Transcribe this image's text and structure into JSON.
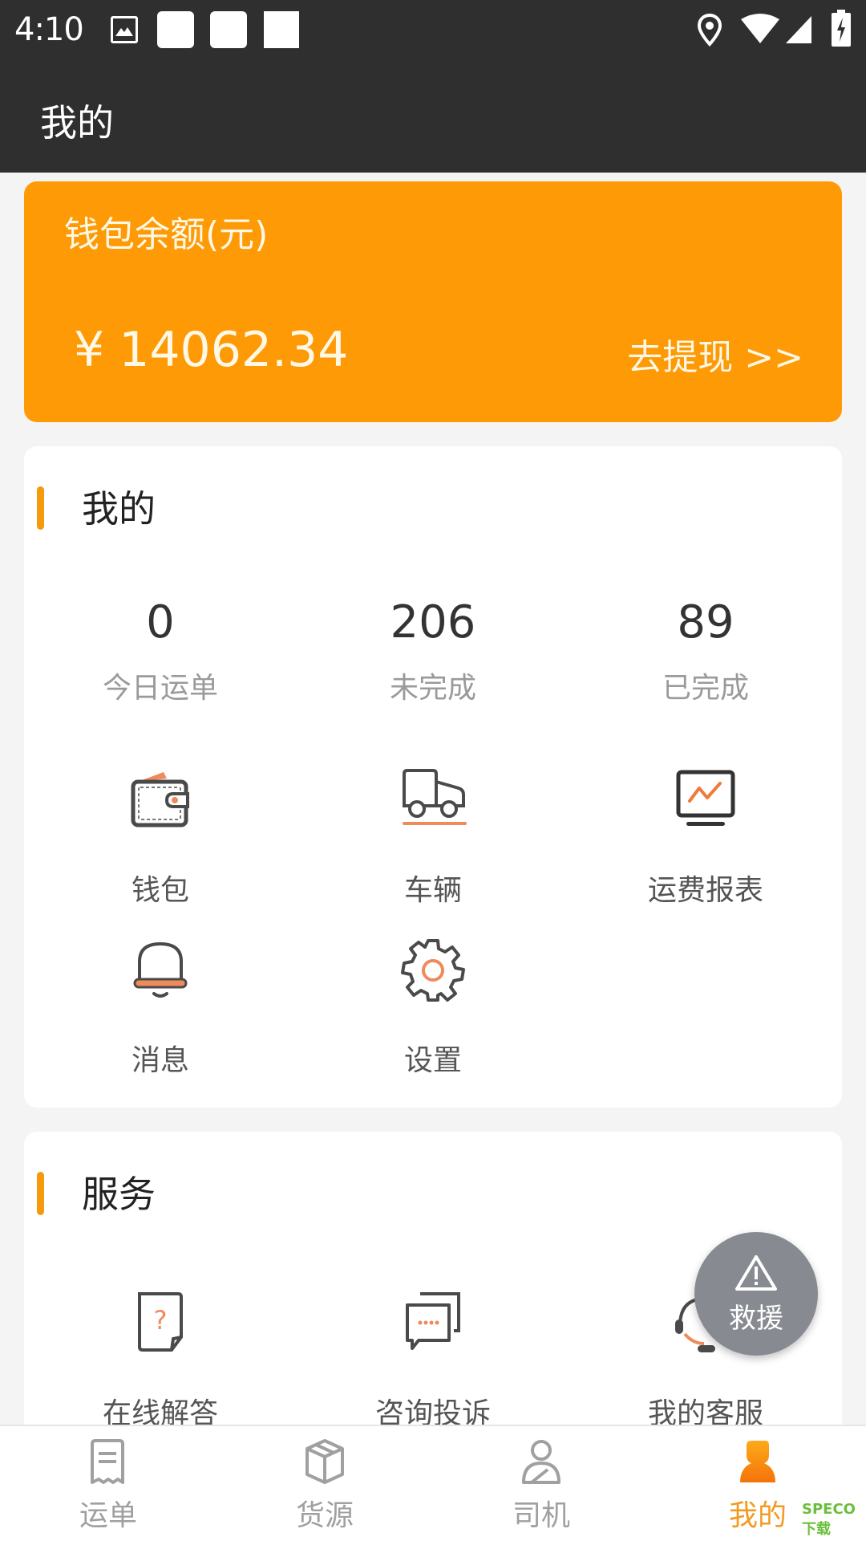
{
  "status_bar": {
    "time": "4:10",
    "left_icons": [
      "image-icon",
      "notification-placeholder",
      "notification-placeholder",
      "notification-placeholder"
    ],
    "right_icons": [
      "location-icon",
      "wifi-icon",
      "signal-icon",
      "battery-charging-icon"
    ]
  },
  "app_bar": {
    "title": "我的"
  },
  "wallet": {
    "label": "钱包余额(元)",
    "currency_symbol": "¥",
    "balance": "14062.34",
    "withdraw_label": "去提现 >>",
    "background_color": "#fd9a06"
  },
  "mine_section": {
    "title": "我的",
    "stats": [
      {
        "value": "0",
        "label": "今日运单"
      },
      {
        "value": "206",
        "label": "未完成"
      },
      {
        "value": "89",
        "label": "已完成"
      }
    ],
    "items": [
      {
        "label": "钱包",
        "icon": "wallet-icon"
      },
      {
        "label": "车辆",
        "icon": "truck-icon"
      },
      {
        "label": "运费报表",
        "icon": "report-chart-icon"
      },
      {
        "label": "消息",
        "icon": "bell-icon"
      },
      {
        "label": "设置",
        "icon": "gear-icon"
      }
    ]
  },
  "service_section": {
    "title": "服务",
    "items": [
      {
        "label": "在线解答",
        "icon": "question-doc-icon"
      },
      {
        "label": "咨询投诉",
        "icon": "chat-bubbles-icon"
      },
      {
        "label": "我的客服",
        "icon": "headset-icon"
      }
    ]
  },
  "rescue_button": {
    "label": "救援",
    "icon": "warning-triangle-icon"
  },
  "bottom_nav": {
    "active_index": 3,
    "items": [
      {
        "label": "运单",
        "icon": "waybill-icon"
      },
      {
        "label": "货源",
        "icon": "package-box-icon"
      },
      {
        "label": "司机",
        "icon": "driver-icon"
      },
      {
        "label": "我的",
        "icon": "user-icon"
      }
    ]
  },
  "watermark": "SPECO下载",
  "colors": {
    "accent": "#fd9a06",
    "section_bar": "#f49a0c",
    "icon_accent": "#ef8a5a",
    "icon_stroke": "#4a4a4a",
    "fab": "#878a91"
  }
}
